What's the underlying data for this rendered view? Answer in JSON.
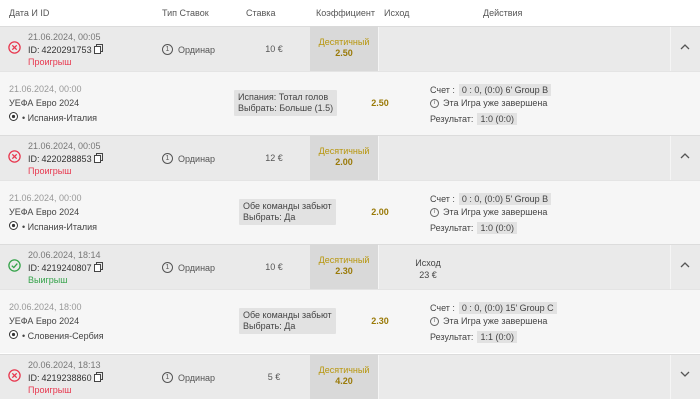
{
  "header": {
    "date_id": "Дата И ID",
    "type": "Тип Ставок",
    "stake": "Ставка",
    "coef": "Коэффициент",
    "outcome": "Исход",
    "actions": "Действия"
  },
  "labels": {
    "id_prefix": "ID:",
    "score": "Счет :",
    "finished": "Эта Игра уже завершена",
    "result": "Результат:"
  },
  "colors": {
    "lost": "#e8384f",
    "won": "#35a34a",
    "coef": "#b8960c"
  },
  "bets": [
    {
      "date": "21.06.2024, 00:05",
      "id": "4220291753",
      "status": "Проигрыш",
      "status_kind": "lost",
      "type": "Ординар",
      "type_num": "1",
      "stake": "10 €",
      "coef_label": "Десятичный",
      "coef_value": "2.50",
      "outcome_label": "",
      "outcome_value": "",
      "detail": {
        "date": "21.06.2024, 00:00",
        "league": "УЕФА Евро 2024",
        "match": "• Испания-Италия",
        "market_line1": "Испания: Тотал голов",
        "market_line2": "Выбрать: Больше (1.5)",
        "coef": "2.50",
        "score": "0 : 0, (0:0) 6' Group B",
        "result": "1:0 (0:0)"
      }
    },
    {
      "date": "21.06.2024, 00:05",
      "id": "4220288853",
      "status": "Проигрыш",
      "status_kind": "lost",
      "type": "Ординар",
      "type_num": "1",
      "stake": "12 €",
      "coef_label": "Десятичный",
      "coef_value": "2.00",
      "outcome_label": "",
      "outcome_value": "",
      "detail": {
        "date": "21.06.2024, 00:00",
        "league": "УЕФА Евро 2024",
        "match": "• Испания-Италия",
        "market_line1": "Обе команды забьют",
        "market_line2": "Выбрать: Да",
        "coef": "2.00",
        "score": "0 : 0, (0:0) 5' Group B",
        "result": "1:0 (0:0)"
      }
    },
    {
      "date": "20.06.2024, 18:14",
      "id": "4219240807",
      "status": "Выигрыш",
      "status_kind": "won",
      "type": "Ординар",
      "type_num": "1",
      "stake": "10 €",
      "coef_label": "Десятичный",
      "coef_value": "2.30",
      "outcome_label": "Исход",
      "outcome_value": "23 €",
      "detail": {
        "date": "20.06.2024, 18:00",
        "league": "УЕФА Евро 2024",
        "match": "• Словения-Сербия",
        "market_line1": "Обе команды забьют",
        "market_line2": "Выбрать: Да",
        "coef": "2.30",
        "score": "0 : 0, (0:0) 15' Group C",
        "result": "1:1 (0:0)"
      }
    },
    {
      "date": "20.06.2024, 18:13",
      "id": "4219238860",
      "status": "Проигрыш",
      "status_kind": "lost",
      "type": "Ординар",
      "type_num": "1",
      "stake": "5 €",
      "coef_label": "Десятичный",
      "coef_value": "4.20",
      "outcome_label": "",
      "outcome_value": ""
    }
  ]
}
